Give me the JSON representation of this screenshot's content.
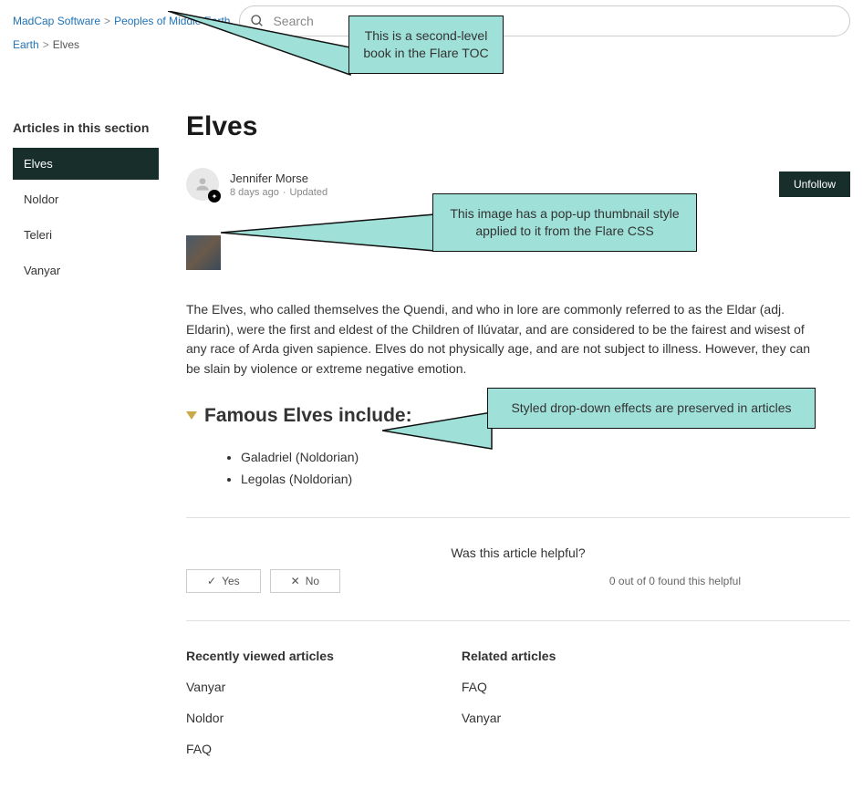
{
  "breadcrumb": {
    "seg1": "MadCap Software",
    "seg2": "Peoples of Middle Earth",
    "seg3": "Earth",
    "current": "Elves"
  },
  "search": {
    "placeholder": "Search"
  },
  "sidebar": {
    "heading": "Articles in this section",
    "items": [
      "Elves",
      "Noldor",
      "Teleri",
      "Vanyar"
    ]
  },
  "article": {
    "title": "Elves",
    "author": "Jennifer Morse",
    "timestamp": "8 days ago",
    "updated": "Updated",
    "unfollow_label": "Unfollow",
    "body": "The Elves, who called themselves the Quendi, and who in lore are commonly referred to as the Eldar (adj. Eldarin), were the first and eldest of the Children of Ilúvatar, and are considered to be the fairest and wisest of any race of Arda given sapience. Elves do not physically age, and are not subject to illness. However, they can be slain by violence or extreme negative emotion.",
    "dropdown_heading": "Famous Elves include:",
    "famous": [
      "Galadriel (Noldorian)",
      "Legolas (Noldorian)"
    ]
  },
  "feedback": {
    "question": "Was this article helpful?",
    "yes": "Yes",
    "no": "No",
    "count_text": "0 out of 0 found this helpful"
  },
  "recent": {
    "heading": "Recently viewed articles",
    "items": [
      "Vanyar",
      "Noldor",
      "FAQ"
    ]
  },
  "related": {
    "heading": "Related articles",
    "items": [
      "FAQ",
      "Vanyar"
    ]
  },
  "callouts": {
    "toc": "This is a second-level book in the Flare TOC",
    "thumb": "This image has a pop-up thumbnail style applied to it from the Flare CSS",
    "dropdown": "Styled drop-down effects are preserved in articles"
  }
}
